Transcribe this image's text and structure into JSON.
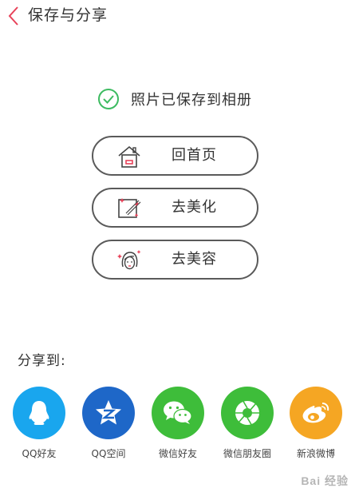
{
  "header": {
    "title": "保存与分享",
    "back_icon": "chevron-left-icon",
    "back_color": "#e8435a"
  },
  "saved": {
    "text": "照片已保存到相册",
    "icon": "check-circle-icon",
    "icon_color": "#3dbb61"
  },
  "actions": [
    {
      "label": "回首页",
      "icon": "home-icon"
    },
    {
      "label": "去美化",
      "icon": "magic-wand-icon"
    },
    {
      "label": "去美容",
      "icon": "face-makeup-icon"
    }
  ],
  "share": {
    "title": "分享到:",
    "items": [
      {
        "label": "QQ好友",
        "icon": "qq-icon",
        "color": "#19a6ee"
      },
      {
        "label": "QQ空间",
        "icon": "qzone-icon",
        "color": "#1e67c8"
      },
      {
        "label": "微信好友",
        "icon": "wechat-icon",
        "color": "#3ebd3a"
      },
      {
        "label": "微信朋友圈",
        "icon": "moments-icon",
        "color": "#3ebd3a"
      },
      {
        "label": "新浪微博",
        "icon": "weibo-icon",
        "color": "#f5a623"
      }
    ]
  },
  "watermark": "Bai 经验"
}
